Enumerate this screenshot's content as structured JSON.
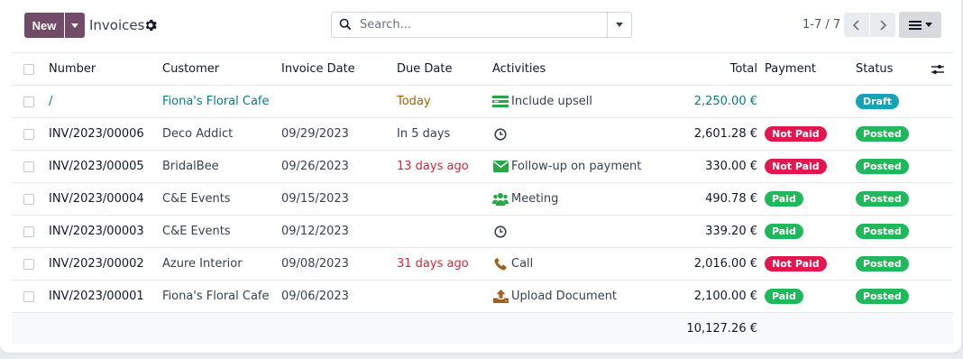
{
  "control": {
    "new_label": "New",
    "title": "Invoices",
    "search_placeholder": "Search...",
    "pager": "1-7 / 7"
  },
  "columns": {
    "number": "Number",
    "customer": "Customer",
    "invoice_date": "Invoice Date",
    "due_date": "Due Date",
    "activities": "Activities",
    "total": "Total",
    "payment": "Payment",
    "status": "Status"
  },
  "rows": [
    {
      "number": "/",
      "customer": "Fiona's Floral Cafe",
      "invoice_date": "",
      "due_date": "Today",
      "due_style": "today",
      "activity": "Include upsell",
      "activity_icon": "list-icon",
      "total": "2,250.00 €",
      "total_link": true,
      "payment": "",
      "status": "Draft"
    },
    {
      "number": "INV/2023/00006",
      "customer": "Deco Addict",
      "invoice_date": "09/29/2023",
      "due_date": "In 5 days",
      "due_style": "normal",
      "activity": "",
      "activity_icon": "clock-icon",
      "total": "2,601.28 €",
      "payment": "Not Paid",
      "status": "Posted"
    },
    {
      "number": "INV/2023/00005",
      "customer": "BridalBee",
      "invoice_date": "09/26/2023",
      "due_date": "13 days ago",
      "due_style": "overdue",
      "activity": "Follow-up on payment",
      "activity_icon": "envelope-icon",
      "total": "330.00 €",
      "payment": "Not Paid",
      "status": "Posted"
    },
    {
      "number": "INV/2023/00004",
      "customer": "C&E Events",
      "invoice_date": "09/15/2023",
      "due_date": "",
      "due_style": "normal",
      "activity": "Meeting",
      "activity_icon": "users-icon",
      "total": "490.78 €",
      "payment": "Paid",
      "status": "Posted"
    },
    {
      "number": "INV/2023/00003",
      "customer": "C&E Events",
      "invoice_date": "09/12/2023",
      "due_date": "",
      "due_style": "normal",
      "activity": "",
      "activity_icon": "clock-icon",
      "total": "339.20 €",
      "payment": "Paid",
      "status": "Posted"
    },
    {
      "number": "INV/2023/00002",
      "customer": "Azure Interior",
      "invoice_date": "09/08/2023",
      "due_date": "31 days ago",
      "due_style": "overdue",
      "activity": "Call",
      "activity_icon": "phone-icon",
      "total": "2,016.00 €",
      "payment": "Not Paid",
      "status": "Posted"
    },
    {
      "number": "INV/2023/00001",
      "customer": "Fiona's Floral Cafe",
      "invoice_date": "09/06/2023",
      "due_date": "",
      "due_style": "normal",
      "activity": "Upload Document",
      "activity_icon": "upload-icon",
      "total": "2,100.00 €",
      "payment": "Paid",
      "status": "Posted"
    }
  ],
  "footer": {
    "total": "10,127.26 €"
  },
  "colors": {
    "brand": "#714b67",
    "link": "#017e84",
    "overdue": "#d9233a",
    "today": "#a16207",
    "draft_badge": "#17a2b8",
    "success_badge": "#1fb85a",
    "danger_badge": "#e4164f",
    "activity_icon": "#28a745"
  }
}
